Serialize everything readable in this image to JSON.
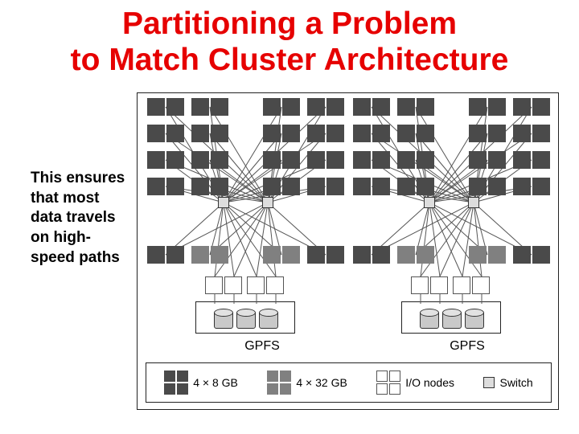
{
  "title_line1": "Partitioning a Problem",
  "title_line2": "to Match Cluster Architecture",
  "side_text": "This ensures that most data travels on high-speed paths",
  "gpfs_label": "GPFS",
  "legend": {
    "item1": "4 × 8 GB",
    "item2": "4 × 32 GB",
    "item3": "I/O nodes",
    "item4": "Switch"
  },
  "diagram": {
    "clusters": 2,
    "per_cluster": {
      "dark_nodes": "4 pairs per row × 4 rows, outer columns (4×8 GB)",
      "mid_nodes": "2 pairs (4×32 GB) bottom-row inner columns",
      "switches": 2,
      "io_nodes": 4,
      "gpfs_disks": 3
    },
    "node_types": {
      "dark_square": "4 × 8 GB",
      "gray_square": "4 × 32 GB",
      "outline_square": "I/O node",
      "small_square": "Switch"
    }
  }
}
